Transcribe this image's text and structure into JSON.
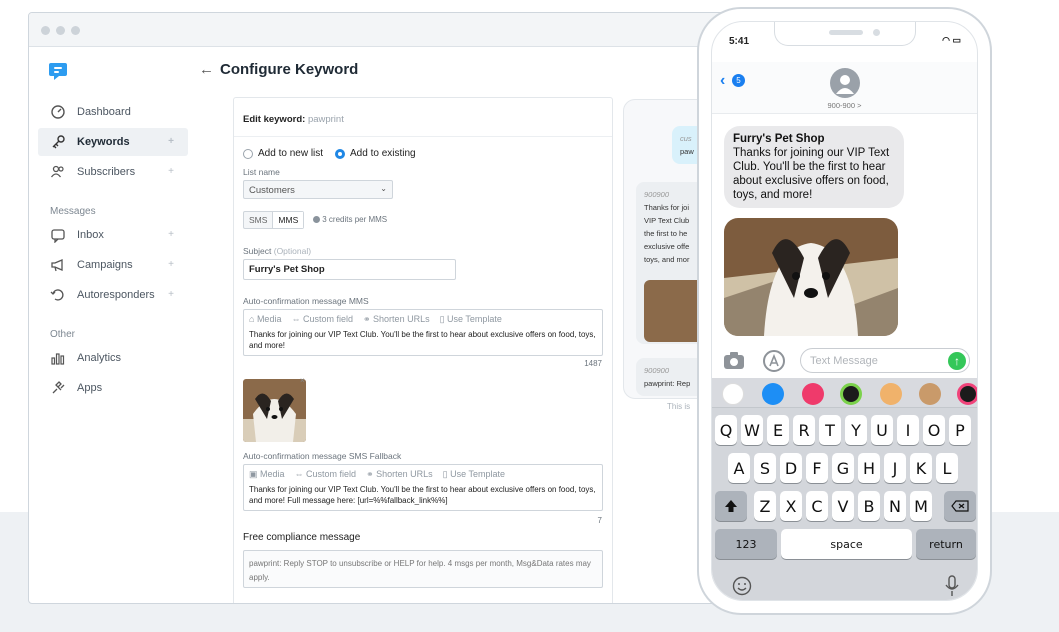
{
  "sidebar": {
    "items": [
      {
        "label": "Dashboard",
        "icon": "speedometer-icon",
        "active": false,
        "plus": false
      },
      {
        "label": "Keywords",
        "icon": "key-icon",
        "active": true,
        "plus": true
      },
      {
        "label": "Subscribers",
        "icon": "subscribers-icon",
        "active": false,
        "plus": true
      }
    ],
    "messages_header": "Messages",
    "message_items": [
      {
        "label": "Inbox",
        "icon": "inbox-icon",
        "plus": true
      },
      {
        "label": "Campaigns",
        "icon": "megaphone-icon",
        "plus": true
      },
      {
        "label": "Autoresponders",
        "icon": "autoresponder-icon",
        "plus": true
      }
    ],
    "other_header": "Other",
    "other_items": [
      {
        "label": "Analytics",
        "icon": "analytics-icon"
      },
      {
        "label": "Apps",
        "icon": "apps-icon"
      }
    ],
    "plus_symbol": "+"
  },
  "header": {
    "back": "←",
    "title": "Configure Keyword"
  },
  "form": {
    "edit_label": "Edit keyword:",
    "keyword": "pawprint",
    "add_new": "Add to new list",
    "add_existing": "Add to existing",
    "list_name_label": "List name",
    "list_name_value": "Customers",
    "sms_tab": "SMS",
    "mms_tab": "MMS",
    "credits_note": "3 credits per MMS",
    "subject_label": "Subject",
    "subject_optional": "(Optional)",
    "subject_value": "Furry's Pet Shop",
    "mms_label": "Auto-confirmation message MMS",
    "toolbar": {
      "media": "Media",
      "custom_field": "Custom field",
      "shorten": "Shorten URLs",
      "template": "Use Template"
    },
    "mms_text": "Thanks for joining our VIP Text Club. You'll be the first to hear about exclusive offers on food, toys, and more!",
    "mms_count": "1487",
    "sms_fallback_label": "Auto-confirmation message SMS Fallback",
    "sms_text": "Thanks for joining our VIP Text Club. You'll be the first to hear about exclusive offers on food, toys, and more! Full message here: [url=%%fallback_link%%]",
    "sms_count": "7",
    "compliance_label": "Free compliance message",
    "compliance_text": "pawprint: Reply STOP to unsubscribe or HELP for help. 4 msgs per month, Msg&Data rates may apply."
  },
  "preview": {
    "top_bubble_1": "cus",
    "top_bubble_2": "paw",
    "number_1": "900900",
    "text_lines": [
      "Thanks for joi",
      "VIP Text Club",
      "the first to he",
      "exclusive offe",
      "toys, and mor"
    ],
    "number_2": "900900",
    "bottom_text": "pawprint: Rep",
    "footer": "This is"
  },
  "phone": {
    "time": "5:41",
    "back_badge": "5",
    "contact": "900-900 >",
    "message_title": "Furry's Pet Shop",
    "message_body": "Thanks for joining our VIP Text Club. You'll be the first to hear about exclusive offers on food, toys, and more!",
    "placeholder": "Text Message",
    "keyboard": {
      "row1": [
        "Q",
        "W",
        "E",
        "R",
        "T",
        "Y",
        "U",
        "I",
        "O",
        "P"
      ],
      "row2": [
        "A",
        "S",
        "D",
        "F",
        "G",
        "H",
        "J",
        "K",
        "L"
      ],
      "row3": [
        "Z",
        "X",
        "C",
        "V",
        "B",
        "N",
        "M"
      ],
      "numbers": "123",
      "space": "space",
      "return": "return"
    }
  },
  "colors": {
    "accent": "#1f87e5",
    "send": "#34c759",
    "imessage_bubble": "#e9e9eb"
  }
}
